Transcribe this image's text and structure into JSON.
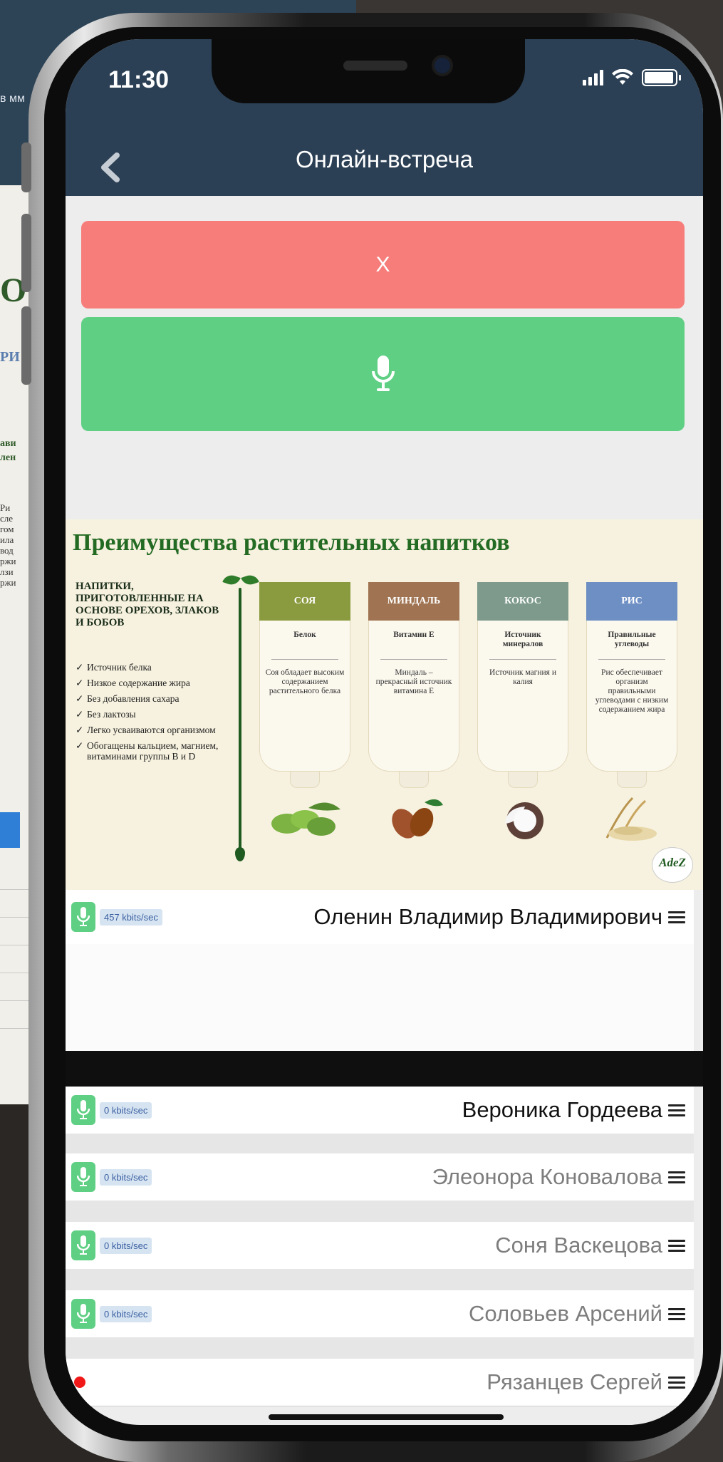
{
  "background": {
    "time_fragment": "в мм",
    "snippets": [
      "О",
      "РИ",
      "ави",
      "лен",
      "Ри",
      "сле",
      "гом",
      "ила",
      "вод",
      "ржи",
      "лзи",
      "ржи"
    ]
  },
  "status_bar": {
    "time": "11:30"
  },
  "header": {
    "title": "Онлайн-встреча",
    "back_icon": "chevron-left-icon"
  },
  "actions": {
    "close_label": "X",
    "mic_icon": "microphone-icon",
    "colors": {
      "close": "#f67d7a",
      "mic": "#5fcf84"
    }
  },
  "slide": {
    "title": "Преимущества растительных напитков",
    "heading": "НАПИТКИ, ПРИГОТОВЛЕННЫЕ НА ОСНОВЕ ОРЕХОВ, ЗЛАКОВ И БОБОВ",
    "bullets": [
      "Источник белка",
      "Низкое содержание жира",
      "Без добавления сахара",
      "Без лактозы",
      "Легко усваиваются организмом",
      "Обогащены кальцием, магнием, витаминами группы В и D"
    ],
    "bottles": [
      {
        "name": "СОЯ",
        "head": "Белок",
        "text": "Соя обладает высоким содержанием растительного белка",
        "color": "#8a9a3e"
      },
      {
        "name": "МИНДАЛЬ",
        "head": "Витамин Е",
        "text": "Миндаль – прекрасный источник витамина Е",
        "color": "#a07452"
      },
      {
        "name": "КОКОС",
        "head": "Источник минералов",
        "text": "Источник магния и калия",
        "color": "#7d9a8c"
      },
      {
        "name": "РИС",
        "head": "Правильные углеводы",
        "text": "Рис обеспечивает организм правильными углеводами с низким содержанием жира",
        "color": "#6e8fc4"
      }
    ],
    "logo": "AdeZ"
  },
  "speaker": {
    "rate": "457 kbits/sec",
    "name": "Оленин Владимир Владимирович"
  },
  "participants": [
    {
      "name": "Вероника Гордеева",
      "rate": "0 kbits/sec",
      "muted_text": false,
      "mic": true
    },
    {
      "name": "Элеонора Коновалова",
      "rate": "0 kbits/sec",
      "muted_text": true,
      "mic": true
    },
    {
      "name": "Соня Васкецова",
      "rate": "0 kbits/sec",
      "muted_text": true,
      "mic": true
    },
    {
      "name": "Соловьев Арсений",
      "rate": "0 kbits/sec",
      "muted_text": true,
      "mic": true
    },
    {
      "name": "Рязанцев Сергей",
      "rate": "",
      "muted_text": true,
      "mic": false
    }
  ]
}
